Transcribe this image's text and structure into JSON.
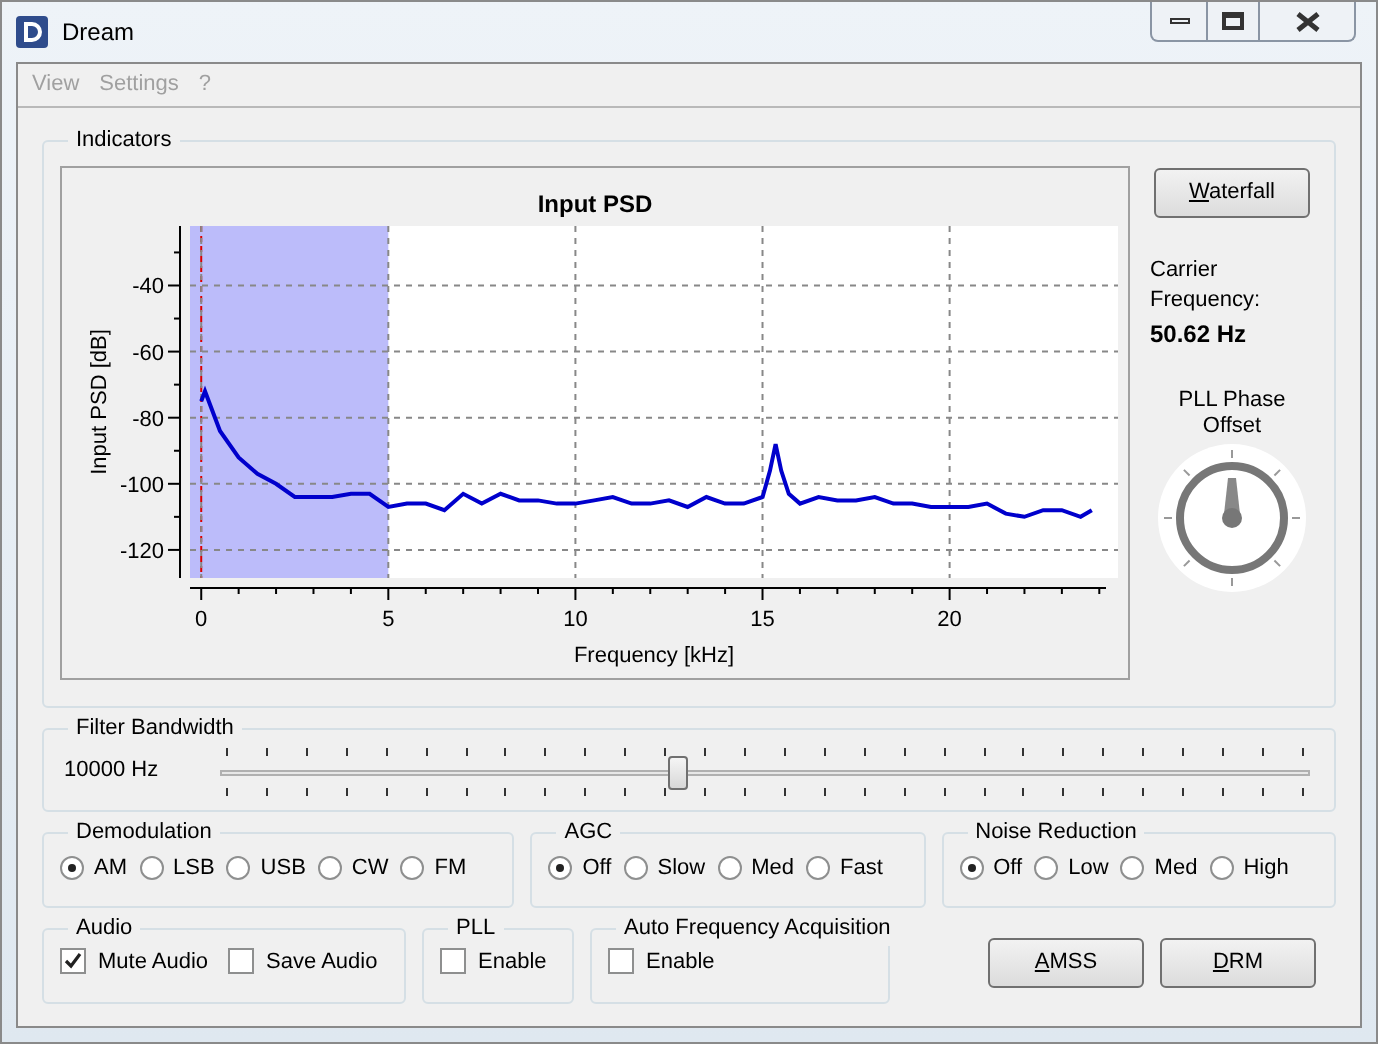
{
  "window": {
    "title": "Dream"
  },
  "menu": [
    {
      "label": "View",
      "disabled": true
    },
    {
      "label": "Settings",
      "disabled": true
    },
    {
      "label": "?",
      "disabled": true
    }
  ],
  "indicators": {
    "title": "Indicators",
    "chart_data": {
      "type": "line",
      "title": "Input PSD",
      "xlabel": "Frequency [kHz]",
      "ylabel": "Input PSD [dB]",
      "x": [
        0,
        0.1,
        0.5,
        1,
        1.5,
        2,
        2.5,
        3,
        3.5,
        4,
        4.5,
        5,
        5.5,
        6,
        6.5,
        7,
        7.5,
        8,
        8.5,
        9,
        9.5,
        10,
        10.5,
        11,
        11.5,
        12,
        12.5,
        13,
        13.5,
        14,
        14.5,
        15,
        15.2,
        15.35,
        15.5,
        15.7,
        16,
        16.5,
        17,
        17.5,
        18,
        18.5,
        19,
        19.5,
        20,
        20.5,
        21,
        21.5,
        22,
        22.5,
        23,
        23.5,
        23.8
      ],
      "series": [
        {
          "color": "#0000cc",
          "values": [
            -75,
            -72,
            -84,
            -92,
            -97,
            -100,
            -104,
            -104,
            -104,
            -103,
            -103,
            -107,
            -106,
            -106,
            -108,
            -103,
            -106,
            -103,
            -105,
            -105,
            -106,
            -106,
            -105,
            -104,
            -106,
            -106,
            -105,
            -107,
            -104,
            -106,
            -106,
            -104,
            -96,
            -88,
            -96,
            -103,
            -106,
            -104,
            -105,
            -105,
            -104,
            -106,
            -106,
            -107,
            -107,
            -107,
            -106,
            -109,
            -110,
            -108,
            -108,
            -110,
            -108
          ]
        }
      ],
      "xlim": [
        -0.3,
        24.5
      ],
      "ylim": [
        -128.5,
        -22
      ],
      "xticks": [
        0,
        5,
        10,
        15,
        20
      ],
      "yticks": [
        -40,
        -60,
        -80,
        -100,
        -120
      ],
      "grid": true,
      "bands": [
        {
          "axis": "x",
          "from": -0.3,
          "to": 5,
          "color": "#bcbcfa"
        }
      ],
      "ref_lines": [
        {
          "axis": "x",
          "value": 0,
          "color": "#dd0000"
        }
      ]
    },
    "waterfall_button": {
      "label": "Waterfall",
      "mnemonic": true
    },
    "carrier": {
      "label": "Carrier Frequency:",
      "value": "50.62 Hz"
    },
    "pll_label": "PLL Phase Offset"
  },
  "filter_bandwidth": {
    "title": "Filter Bandwidth",
    "value": "10000 Hz",
    "level": 0.42
  },
  "option_groups": [
    {
      "title": "Demodulation",
      "options": [
        {
          "label": "AM",
          "selected": true
        },
        {
          "label": "LSB",
          "selected": false
        },
        {
          "label": "USB",
          "selected": false
        },
        {
          "label": "CW",
          "selected": false
        },
        {
          "label": "FM",
          "selected": false
        }
      ]
    },
    {
      "title": "AGC",
      "options": [
        {
          "label": "Off",
          "selected": true
        },
        {
          "label": "Slow",
          "selected": false
        },
        {
          "label": "Med",
          "selected": false
        },
        {
          "label": "Fast",
          "selected": false
        }
      ]
    },
    {
      "title": "Noise Reduction",
      "options": [
        {
          "label": "Off",
          "selected": true
        },
        {
          "label": "Low",
          "selected": false
        },
        {
          "label": "Med",
          "selected": false
        },
        {
          "label": "High",
          "selected": false
        }
      ]
    }
  ],
  "check_groups": [
    {
      "title": "Audio",
      "items": [
        {
          "label": "Mute Audio",
          "checked": true
        },
        {
          "label": "Save Audio",
          "checked": false
        }
      ]
    },
    {
      "title": "PLL",
      "items": [
        {
          "label": "Enable",
          "checked": false
        }
      ]
    },
    {
      "title": "Auto Frequency Acquisition",
      "items": [
        {
          "label": "Enable",
          "checked": false
        }
      ]
    }
  ],
  "buttons": [
    {
      "label": "AMSS",
      "mnemonic": true
    },
    {
      "label": "DRM",
      "mnemonic": true
    }
  ]
}
